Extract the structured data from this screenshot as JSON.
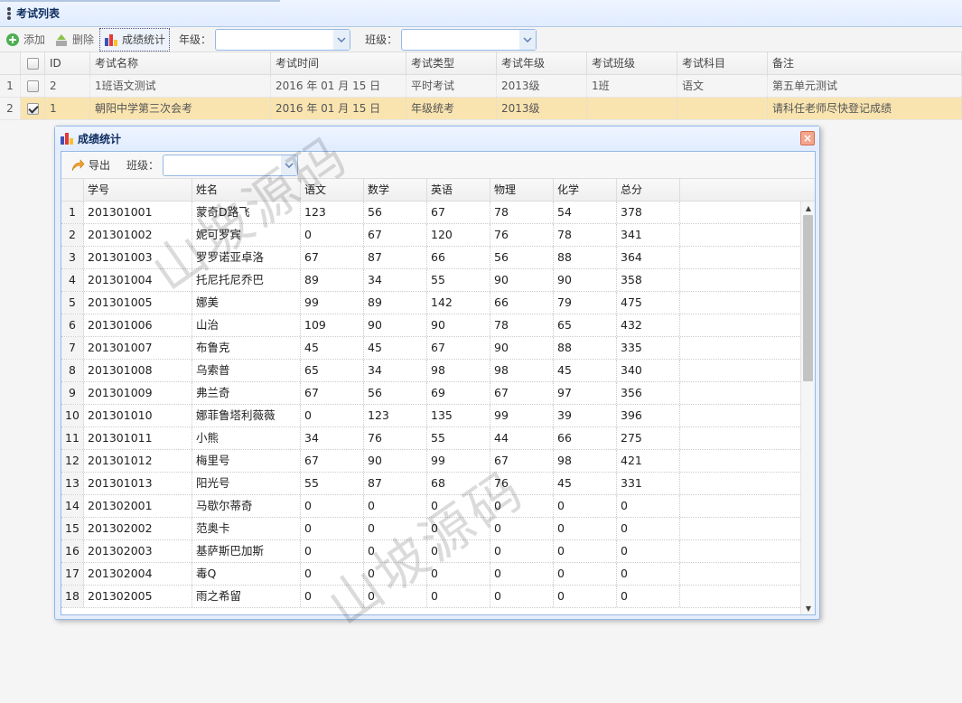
{
  "panel": {
    "title": "考试列表"
  },
  "toolbar": {
    "add": "添加",
    "delete": "删除",
    "stats": "成绩统计",
    "grade_label": "年级：",
    "grade_value": "",
    "class_label": "班级：",
    "class_value": ""
  },
  "exam_table": {
    "headers": [
      "ID",
      "考试名称",
      "考试时间",
      "考试类型",
      "考试年级",
      "考试班级",
      "考试科目",
      "备注"
    ],
    "rows": [
      {
        "rn": "1",
        "checked": false,
        "cells": [
          "2",
          "1班语文测试",
          "2016 年 01 月 15 日",
          "平时考试",
          "2013级",
          "1班",
          "语文",
          "第五单元测试"
        ]
      },
      {
        "rn": "2",
        "checked": true,
        "cells": [
          "1",
          "朝阳中学第三次会考",
          "2016 年 01 月 15 日",
          "年级统考",
          "2013级",
          "",
          "",
          "请科任老师尽快登记成绩"
        ]
      }
    ]
  },
  "dialog": {
    "title": "成绩统计",
    "close": "×",
    "export": "导出",
    "class_label": "班级：",
    "class_value": "",
    "headers": [
      "学号",
      "姓名",
      "语文",
      "数学",
      "英语",
      "物理",
      "化学",
      "总分"
    ],
    "rows": [
      [
        "1",
        "201301001",
        "蒙奇D路飞",
        "123",
        "56",
        "67",
        "78",
        "54",
        "378"
      ],
      [
        "2",
        "201301002",
        "妮可罗宾",
        "0",
        "67",
        "120",
        "76",
        "78",
        "341"
      ],
      [
        "3",
        "201301003",
        "罗罗诺亚卓洛",
        "67",
        "87",
        "66",
        "56",
        "88",
        "364"
      ],
      [
        "4",
        "201301004",
        "托尼托尼乔巴",
        "89",
        "34",
        "55",
        "90",
        "90",
        "358"
      ],
      [
        "5",
        "201301005",
        "娜美",
        "99",
        "89",
        "142",
        "66",
        "79",
        "475"
      ],
      [
        "6",
        "201301006",
        "山治",
        "109",
        "90",
        "90",
        "78",
        "65",
        "432"
      ],
      [
        "7",
        "201301007",
        "布鲁克",
        "45",
        "45",
        "67",
        "90",
        "88",
        "335"
      ],
      [
        "8",
        "201301008",
        "乌索普",
        "65",
        "34",
        "98",
        "98",
        "45",
        "340"
      ],
      [
        "9",
        "201301009",
        "弗兰奇",
        "67",
        "56",
        "69",
        "67",
        "97",
        "356"
      ],
      [
        "10",
        "201301010",
        "娜菲鲁塔利薇薇",
        "0",
        "123",
        "135",
        "99",
        "39",
        "396"
      ],
      [
        "11",
        "201301011",
        "小熊",
        "34",
        "76",
        "55",
        "44",
        "66",
        "275"
      ],
      [
        "12",
        "201301012",
        "梅里号",
        "67",
        "90",
        "99",
        "67",
        "98",
        "421"
      ],
      [
        "13",
        "201301013",
        "阳光号",
        "55",
        "87",
        "68",
        "76",
        "45",
        "331"
      ],
      [
        "14",
        "201302001",
        "马歇尔蒂奇",
        "0",
        "0",
        "0",
        "0",
        "0",
        "0"
      ],
      [
        "15",
        "201302002",
        "范奥卡",
        "0",
        "0",
        "0",
        "0",
        "0",
        "0"
      ],
      [
        "16",
        "201302003",
        "基萨斯巴加斯",
        "0",
        "0",
        "0",
        "0",
        "0",
        "0"
      ],
      [
        "17",
        "201302004",
        "毒Q",
        "0",
        "0",
        "0",
        "0",
        "0",
        "0"
      ],
      [
        "18",
        "201302005",
        "雨之希留",
        "0",
        "0",
        "0",
        "0",
        "0",
        "0"
      ]
    ]
  },
  "watermark": "山坡源码",
  "colors": {
    "selected_row": "#f9e4b0",
    "border": "#95b8e7",
    "header_bg": "#e0ecff"
  }
}
